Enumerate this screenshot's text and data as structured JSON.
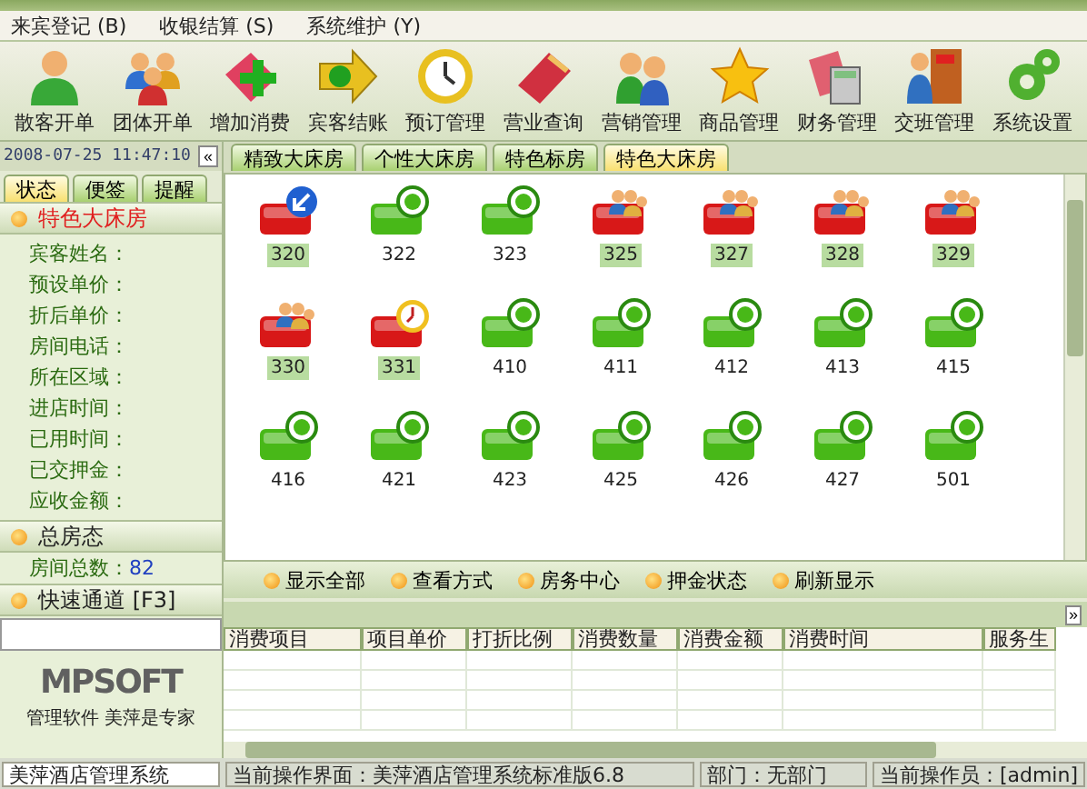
{
  "menu": [
    {
      "label": "来宾登记 (B)"
    },
    {
      "label": "收银结算 (S)"
    },
    {
      "label": "系统维护 (Y)"
    }
  ],
  "toolbar": [
    {
      "label": "散客开单"
    },
    {
      "label": "团体开单"
    },
    {
      "label": "增加消费"
    },
    {
      "label": "宾客结账"
    },
    {
      "label": "预订管理"
    },
    {
      "label": "营业查询"
    },
    {
      "label": "营销管理"
    },
    {
      "label": "商品管理"
    },
    {
      "label": "财务管理"
    },
    {
      "label": "交班管理"
    },
    {
      "label": "系统设置"
    }
  ],
  "datetime": "2008-07-25 11:47:10",
  "collapse_button": "«",
  "room_type_tabs": [
    {
      "label": "精致大床房",
      "selected": false
    },
    {
      "label": "个性大床房",
      "selected": false
    },
    {
      "label": "特色标房",
      "selected": false
    },
    {
      "label": "特色大床房",
      "selected": true
    }
  ],
  "sidebar": {
    "tabs": [
      {
        "label": "状态",
        "selected": true
      },
      {
        "label": "便签",
        "selected": false
      },
      {
        "label": "提醒",
        "selected": false
      }
    ],
    "room_section": {
      "title": "特色大床房",
      "fields": [
        "宾客姓名：",
        "预设单价：",
        "折后单价：",
        "房间电话：",
        "所在区域：",
        "进店时间：",
        "已用时间：",
        "已交押金：",
        "应收金额："
      ]
    },
    "summary_section": {
      "title": "总房态",
      "label": "房间总数：",
      "value": "82"
    },
    "quick_section": {
      "title": "快速通道 [F3]"
    },
    "logo": "MPSOFT",
    "tagline": "管理软件 美萍是专家"
  },
  "rooms": [
    {
      "number": "320",
      "kind": "arrival"
    },
    {
      "number": "322",
      "kind": "vacant"
    },
    {
      "number": "323",
      "kind": "vacant"
    },
    {
      "number": "325",
      "kind": "occupied"
    },
    {
      "number": "327",
      "kind": "occupied"
    },
    {
      "number": "328",
      "kind": "occupied"
    },
    {
      "number": "329",
      "kind": "occupied"
    },
    {
      "number": "330",
      "kind": "occupied"
    },
    {
      "number": "331",
      "kind": "reserved"
    },
    {
      "number": "410",
      "kind": "vacant"
    },
    {
      "number": "411",
      "kind": "vacant"
    },
    {
      "number": "412",
      "kind": "vacant"
    },
    {
      "number": "413",
      "kind": "vacant"
    },
    {
      "number": "415",
      "kind": "vacant"
    },
    {
      "number": "416",
      "kind": "vacant"
    },
    {
      "number": "421",
      "kind": "vacant"
    },
    {
      "number": "423",
      "kind": "vacant"
    },
    {
      "number": "425",
      "kind": "vacant"
    },
    {
      "number": "426",
      "kind": "vacant"
    },
    {
      "number": "427",
      "kind": "vacant"
    },
    {
      "number": "501",
      "kind": "vacant"
    }
  ],
  "actions": [
    {
      "label": "显示全部"
    },
    {
      "label": "查看方式"
    },
    {
      "label": "房务中心"
    },
    {
      "label": "押金状态"
    },
    {
      "label": "刷新显示"
    }
  ],
  "panel_toggle": "»",
  "table": {
    "columns": [
      "消费项目",
      "项目单价",
      "打折比例",
      "消费数量",
      "消费金额",
      "消费时间",
      "服务生"
    ]
  },
  "status_bar": [
    "美萍酒店管理系统",
    "当前操作界面：美萍酒店管理系统标准版6.8",
    "部门：无部门",
    "当前操作员：[admin]"
  ]
}
